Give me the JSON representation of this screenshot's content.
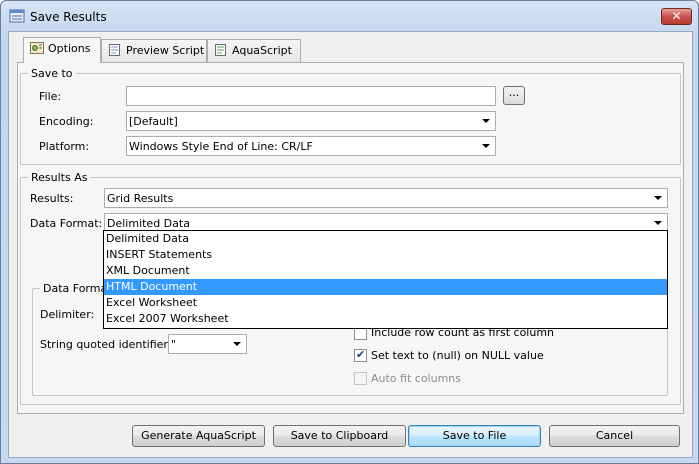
{
  "window": {
    "title": "Save Results",
    "close_glyph": "✕"
  },
  "tabs": [
    {
      "label": "Options",
      "icon": "options-icon",
      "active": true
    },
    {
      "label": "Preview Script",
      "icon": "preview-script-icon",
      "active": false
    },
    {
      "label": "AquaScript",
      "icon": "aquascript-icon",
      "active": false
    }
  ],
  "save_to": {
    "title": "Save to",
    "file_label": "File:",
    "file_value": "",
    "browse_label": "...",
    "encoding_label": "Encoding:",
    "encoding_value": "[Default]",
    "platform_label": "Platform:",
    "platform_value": "Windows Style End of Line: CR/LF"
  },
  "results_as": {
    "title": "Results As",
    "results_label": "Results:",
    "results_value": "Grid Results",
    "data_format_label": "Data Format:",
    "data_format_value": "Delimited Data",
    "options": [
      "Delimited Data",
      "INSERT Statements",
      "XML Document",
      "HTML Document",
      "Excel Worksheet",
      "Excel 2007 Worksheet"
    ],
    "highlighted_option": "HTML Document"
  },
  "data_format_options": {
    "title": "Data Format",
    "delimiter_label": "Delimiter:",
    "string_quoted_label": "String quoted identifier:",
    "string_quoted_value": "\"",
    "include_row_count_label": "Include row count as first column",
    "set_null_label": "Set text to (null) on NULL value",
    "auto_fit_label": "Auto fit columns"
  },
  "buttons": {
    "generate": "Generate AquaScript",
    "clipboard": "Save to Clipboard",
    "save_file": "Save to File",
    "cancel": "Cancel"
  }
}
